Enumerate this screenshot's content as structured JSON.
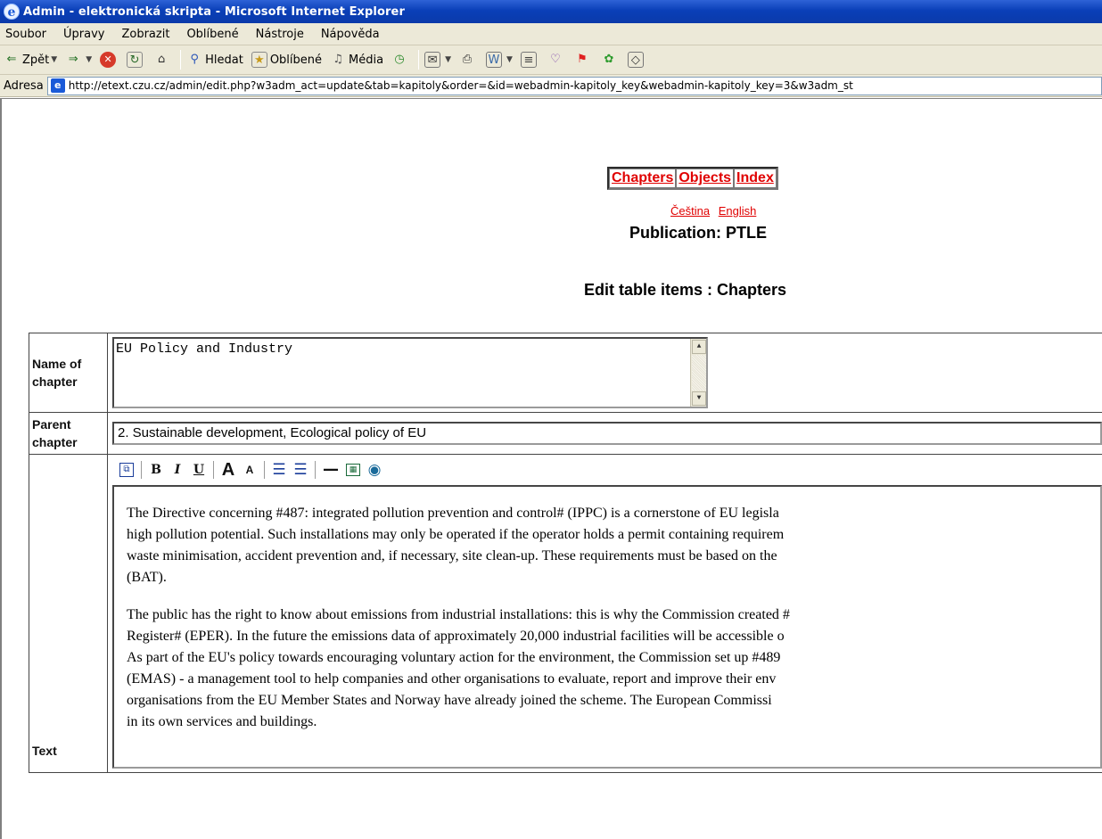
{
  "window": {
    "title": "Admin - elektronická skripta - Microsoft Internet Explorer"
  },
  "menu": [
    {
      "label": "Soubor"
    },
    {
      "label": "Úpravy"
    },
    {
      "label": "Zobrazit"
    },
    {
      "label": "Oblíbené"
    },
    {
      "label": "Nástroje"
    },
    {
      "label": "Nápověda"
    }
  ],
  "toolbar": {
    "back_label": "Zpět",
    "search_label": "Hledat",
    "favorites_label": "Oblíbené",
    "media_label": "Média"
  },
  "address": {
    "label": "Adresa",
    "url": "http://etext.czu.cz/admin/edit.php?w3adm_act=update&tab=kapitoly&order=&id=webadmin-kapitoly_key&webadmin-kapitoly_key=3&w3adm_st"
  },
  "nav": {
    "chapters": "Chapters",
    "objects": "Objects",
    "index": "Index"
  },
  "languages": {
    "czech": "Čeština",
    "english": "English"
  },
  "publication_title": "Publication: PTLE",
  "edit_title": "Edit table items : Chapters",
  "form": {
    "name_label": "Name of chapter",
    "name_value": "EU Policy and Industry",
    "parent_label": "Parent chapter",
    "parent_value": "2. Sustainable development, Ecological policy of EU",
    "text_label": "Text",
    "paragraphs": [
      [
        "The Directive concerning #487: integrated  pollution prevention and control# (IPPC) is a cornerstone of EU  legisla",
        "high pollution  potential. Such installations may only be operated if the operator holds a  permit containing requirem",
        "waste minimisation, accident prevention and, if necessary, site clean-up.  These requirements must be based on the",
        "(BAT)."
      ],
      [
        "The public has the right to know about emissions from industrial  installations: this is why the Commission created #",
        "Register# (EPER). In the future the emissions data  of approximately 20,000 industrial facilities will be accessible o",
        "As part of the EU's policy towards encouraging voluntary action for  the environment, the Commission set up #489",
        "(EMAS) - a management tool to help companies and  other organisations to evaluate, report and improve their env",
        "organisations from the EU Member States and  Norway have already joined the scheme. The European Commissi",
        "in its own services and buildings."
      ]
    ]
  }
}
